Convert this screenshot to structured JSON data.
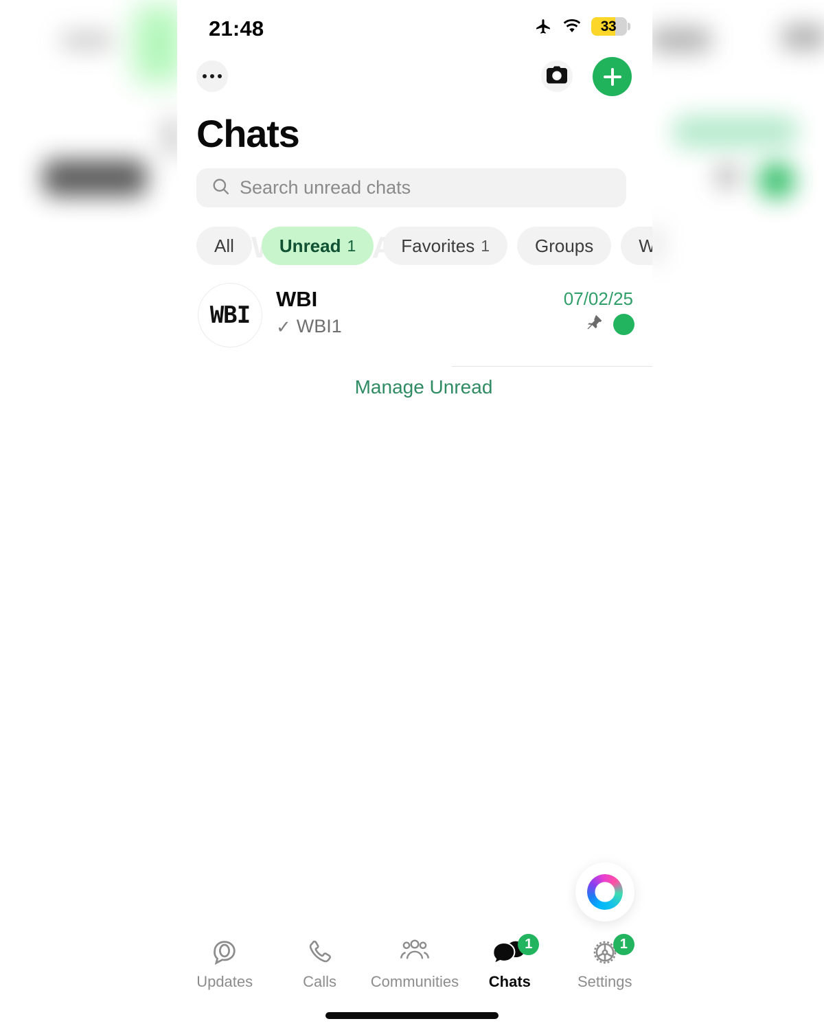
{
  "status_bar": {
    "time": "21:48",
    "airplane_icon": "airplane-mode-icon",
    "wifi_icon": "wifi-icon",
    "battery_percent": "33"
  },
  "nav": {
    "more_label": "more-options",
    "camera_label": "camera",
    "new_chat_label": "new-chat"
  },
  "header": {
    "title": "Chats"
  },
  "search": {
    "placeholder": "Search unread chats",
    "value": "",
    "icon": "search-icon"
  },
  "filters": {
    "watermark": "WABETAINFO",
    "chips": [
      {
        "label": "All",
        "count": ""
      },
      {
        "label": "Unread",
        "count": "1",
        "active": true
      },
      {
        "label": "Favorites",
        "count": "1"
      },
      {
        "label": "Groups",
        "count": ""
      },
      {
        "label": "WE",
        "count": ""
      }
    ]
  },
  "chat_list": {
    "rows": [
      {
        "avatar_initials": "WBI",
        "name": "WBI",
        "status_tick": "✓",
        "preview": "WBI1",
        "time": "07/02/25",
        "pinned": true,
        "unread": true
      }
    ],
    "manage_unread_label": "Manage Unread"
  },
  "assistant": {
    "orb_icon": "siri-orb-icon"
  },
  "tabbar": {
    "tabs": [
      {
        "label": "Updates",
        "icon": "updates-icon",
        "badge": "",
        "active": false
      },
      {
        "label": "Calls",
        "icon": "phone-icon",
        "badge": "",
        "active": false
      },
      {
        "label": "Communities",
        "icon": "communities-icon",
        "badge": "",
        "active": false
      },
      {
        "label": "Chats",
        "icon": "chat-bubbles-icon",
        "badge": "1",
        "active": true
      },
      {
        "label": "Settings",
        "icon": "gear-icon",
        "badge": "1",
        "active": false
      }
    ]
  },
  "colors": {
    "accent_green": "#21b25c",
    "unread_dot": "#22b45f",
    "chip_active_bg": "#c9f5cd",
    "chip_active_text": "#0f5132",
    "link_green": "#2e8b63",
    "battery_yellow": "#fcd628"
  }
}
